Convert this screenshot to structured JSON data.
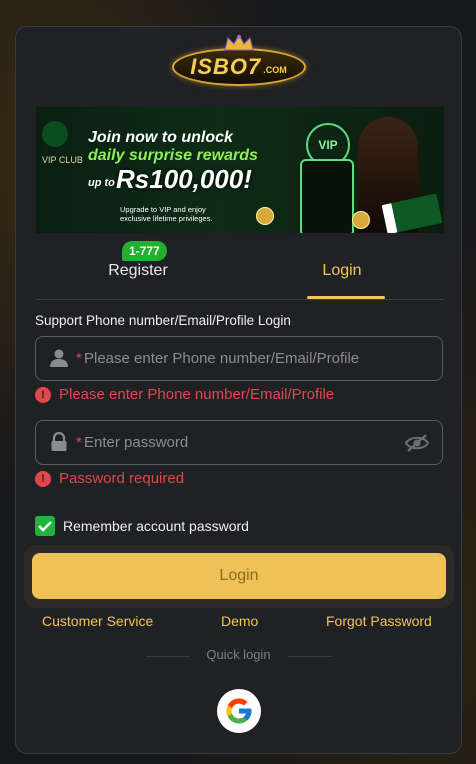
{
  "logo": {
    "text": "ISBO7",
    "suffix": ".COM"
  },
  "banner": {
    "line1": "Join now to unlock",
    "line2": "daily surprise rewards",
    "upto": "up to",
    "amount": "Rs100,000!",
    "sub": "Upgrade to VIP and enjoy exclusive lifetime privileges.",
    "vip_club": "VIP CLUB",
    "vip_badge": "VIP"
  },
  "tabs": {
    "register": "Register",
    "register_badge": "1-777",
    "login": "Login"
  },
  "form": {
    "support_label": "Support Phone number/Email/Profile Login",
    "account_placeholder": "Please enter Phone number/Email/Profile",
    "account_required": "*",
    "account_error": "Please enter Phone number/Email/Profile",
    "password_placeholder": "Enter password",
    "password_required": "*",
    "password_error": "Password required",
    "remember_label": "Remember account password",
    "remember_checked": true,
    "login_button": "Login"
  },
  "links": {
    "customer_service": "Customer Service",
    "demo": "Demo",
    "forgot_password": "Forgot Password"
  },
  "quick_login": {
    "label": "Quick login",
    "providers": [
      "google-icon"
    ]
  },
  "colors": {
    "accent": "#f2c45a",
    "error": "#e0484b",
    "success": "#22b02f",
    "button": "#f0c156"
  }
}
